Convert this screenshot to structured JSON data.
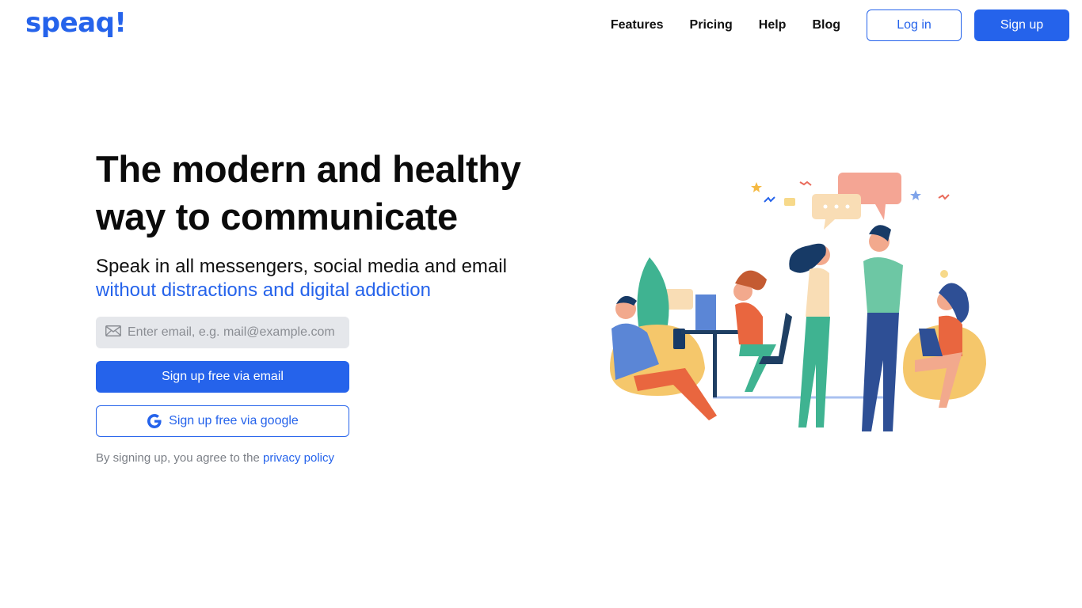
{
  "brand": {
    "logo_text": "speaq!",
    "accent_color": "#2563eb"
  },
  "nav": {
    "links": [
      "Features",
      "Pricing",
      "Help",
      "Blog"
    ],
    "login_label": "Log in",
    "signup_label": "Sign up"
  },
  "hero": {
    "headline_line1": "The modern and healthy",
    "headline_line2": "way to communicate",
    "subheading": "Speak in all messengers, social media and email",
    "subheading_accent": "without distractions and digital addiction",
    "email_placeholder": "Enter email, e.g. mail@example.com",
    "email_value": "",
    "email_button_label": "Sign up free via email",
    "google_button_label": "Sign up free via google",
    "terms_prefix": "By signing up, you agree to the",
    "terms_link_label": "privacy policy"
  },
  "icons": {
    "email_field_icon": "envelope-icon",
    "google_button_icon": "google-icon"
  }
}
